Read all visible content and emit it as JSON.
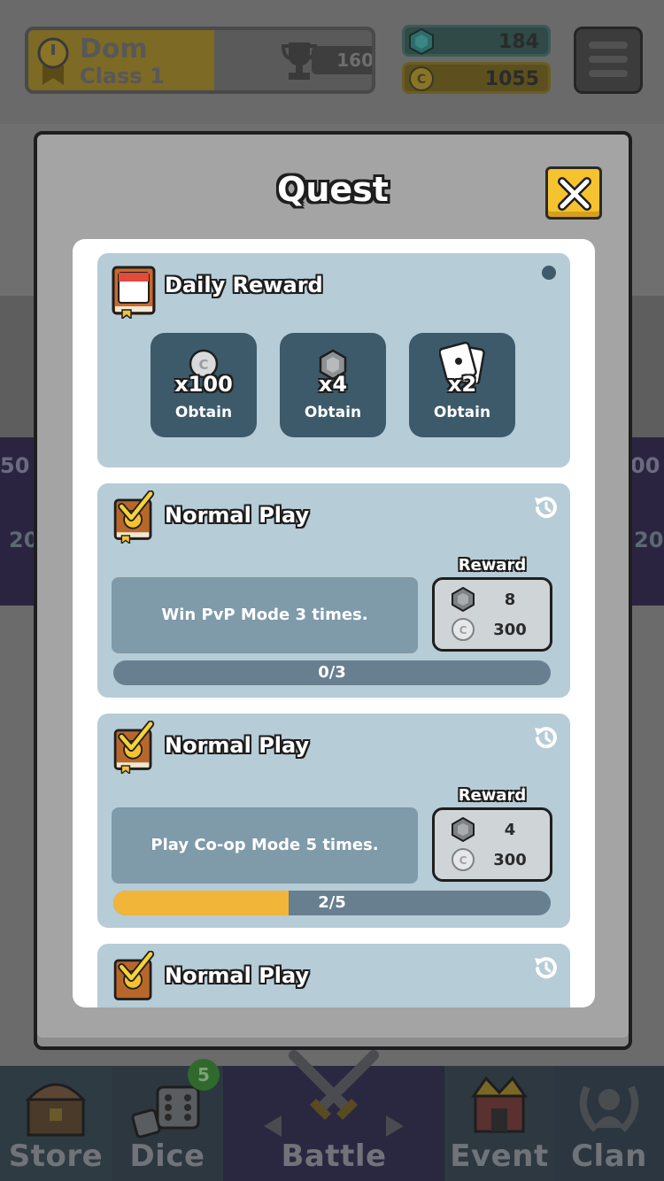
{
  "header": {
    "player_name": "Dom",
    "player_class": "Class 1",
    "trophies": "160",
    "gems": "184",
    "coins": "1055"
  },
  "background": {
    "edge_left_top": "50",
    "edge_right_top": "00",
    "edge_left_mid": "20",
    "edge_right_mid": "20"
  },
  "bottom_nav": {
    "items": [
      {
        "label": "Store",
        "icon": "treasure-chest-icon"
      },
      {
        "label": "Dice",
        "icon": "dice-icon"
      },
      {
        "label": "Battle",
        "icon": "crossed-swords-icon"
      },
      {
        "label": "Event",
        "icon": "crown-tent-icon"
      },
      {
        "label": "Clan",
        "icon": "laurel-person-icon"
      }
    ],
    "dice_badge": "5"
  },
  "modal": {
    "title": "Quest",
    "close_icon": "close-icon"
  },
  "daily": {
    "title": "Daily Reward",
    "items": [
      {
        "amount": "x100",
        "label": "Obtain",
        "icon": "coin-icon"
      },
      {
        "amount": "x4",
        "label": "Obtain",
        "icon": "gem-icon"
      },
      {
        "amount": "x2",
        "label": "Obtain",
        "icon": "card-icon"
      }
    ]
  },
  "quests": [
    {
      "title": "Normal Play",
      "description": "Win PvP Mode 3 times.",
      "reward_label": "Reward",
      "reward_gems": "8",
      "reward_coins": "300",
      "progress_text": "0/3",
      "progress": 0.0
    },
    {
      "title": "Normal Play",
      "description": "Play Co-op Mode 5 times.",
      "reward_label": "Reward",
      "reward_gems": "4",
      "reward_coins": "300",
      "progress_text": "2/5",
      "progress": 0.4
    },
    {
      "title": "Normal Play"
    }
  ],
  "colors": {
    "accent_yellow": "#f5c230",
    "card_bg": "#b6ccd6",
    "progress_fill": "#f1b53a"
  }
}
